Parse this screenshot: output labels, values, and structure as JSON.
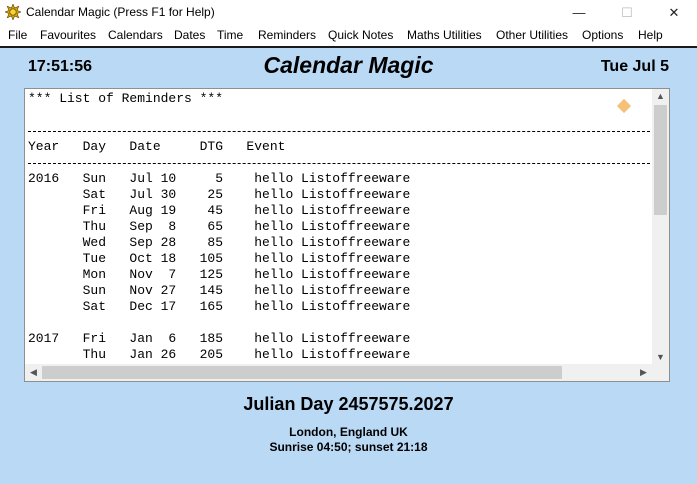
{
  "window": {
    "title": "Calendar Magic (Press F1 for Help)",
    "minimize_glyph": "—",
    "maximize_glyph": "☐",
    "close_glyph": "✕"
  },
  "menu": [
    "File",
    "Favourites",
    "Calendars",
    "Dates",
    "Time",
    "Reminders",
    "Quick Notes",
    "Maths Utilities",
    "Other Utilities",
    "Options",
    "Help"
  ],
  "header": {
    "time": "17:51:56",
    "app_title": "Calendar Magic",
    "date": "Tue Jul 5"
  },
  "reminders": {
    "heading": "*** List of Reminders ***",
    "columns": [
      "Year",
      "Day",
      "Date",
      "DTG",
      "Event"
    ],
    "rows": [
      {
        "year": "2016",
        "day": "Sun",
        "date": "Jul 10",
        "dtg": "5",
        "event": "hello Listoffreeware"
      },
      {
        "year": "",
        "day": "Sat",
        "date": "Jul 30",
        "dtg": "25",
        "event": "hello Listoffreeware"
      },
      {
        "year": "",
        "day": "Fri",
        "date": "Aug 19",
        "dtg": "45",
        "event": "hello Listoffreeware"
      },
      {
        "year": "",
        "day": "Thu",
        "date": "Sep  8",
        "dtg": "65",
        "event": "hello Listoffreeware"
      },
      {
        "year": "",
        "day": "Wed",
        "date": "Sep 28",
        "dtg": "85",
        "event": "hello Listoffreeware"
      },
      {
        "year": "",
        "day": "Tue",
        "date": "Oct 18",
        "dtg": "105",
        "event": "hello Listoffreeware"
      },
      {
        "year": "",
        "day": "Mon",
        "date": "Nov  7",
        "dtg": "125",
        "event": "hello Listoffreeware"
      },
      {
        "year": "",
        "day": "Sun",
        "date": "Nov 27",
        "dtg": "145",
        "event": "hello Listoffreeware"
      },
      {
        "year": "",
        "day": "Sat",
        "date": "Dec 17",
        "dtg": "165",
        "event": "hello Listoffreeware"
      },
      {
        "blank": true
      },
      {
        "year": "2017",
        "day": "Fri",
        "date": "Jan  6",
        "dtg": "185",
        "event": "hello Listoffreeware"
      },
      {
        "year": "",
        "day": "Thu",
        "date": "Jan 26",
        "dtg": "205",
        "event": "hello Listoffreeware"
      }
    ]
  },
  "footer": {
    "julian_day": "Julian Day 2457575.2027",
    "location": "London, England UK",
    "sun_times": "Sunrise 04:50; sunset 21:18"
  },
  "colors": {
    "main_background": "#b9d9f5",
    "diamond": "#f5c078"
  },
  "icons": {
    "app": "sun-gear-icon",
    "diamond": "diamond-icon"
  }
}
